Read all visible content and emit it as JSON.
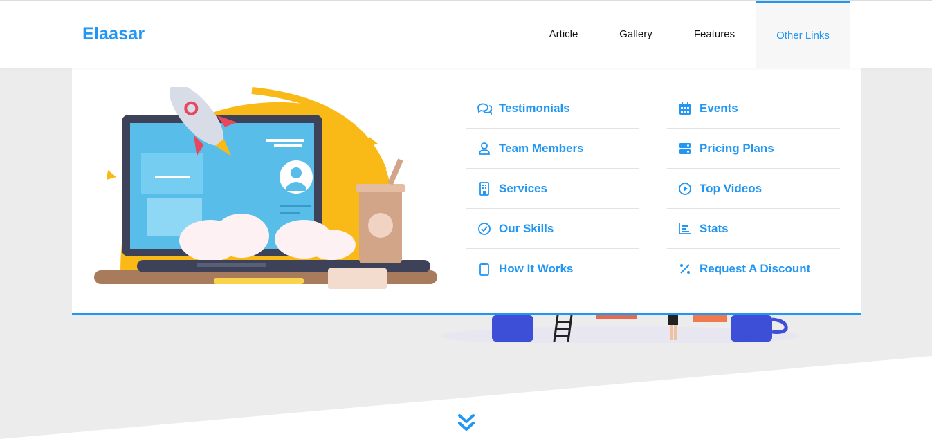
{
  "brand": {
    "name": "Elaasar",
    "accent": "#2196f3"
  },
  "nav": {
    "article": "Article",
    "gallery": "Gallery",
    "features": "Features",
    "other_links": "Other Links"
  },
  "mega_menu": {
    "column1": [
      {
        "label": "Testimonials",
        "icon": "comments-icon"
      },
      {
        "label": "Team Members",
        "icon": "user-icon"
      },
      {
        "label": "Services",
        "icon": "building-icon"
      },
      {
        "label": "Our Skills",
        "icon": "check-circle-icon"
      },
      {
        "label": "How It Works",
        "icon": "clipboard-icon"
      }
    ],
    "column2": [
      {
        "label": "Events",
        "icon": "calendar-icon"
      },
      {
        "label": "Pricing Plans",
        "icon": "server-icon"
      },
      {
        "label": "Top Videos",
        "icon": "play-circle-icon"
      },
      {
        "label": "Stats",
        "icon": "chart-icon"
      },
      {
        "label": "Request A Discount",
        "icon": "percent-icon"
      }
    ]
  },
  "scroll_icon": "chevrons-down-icon"
}
